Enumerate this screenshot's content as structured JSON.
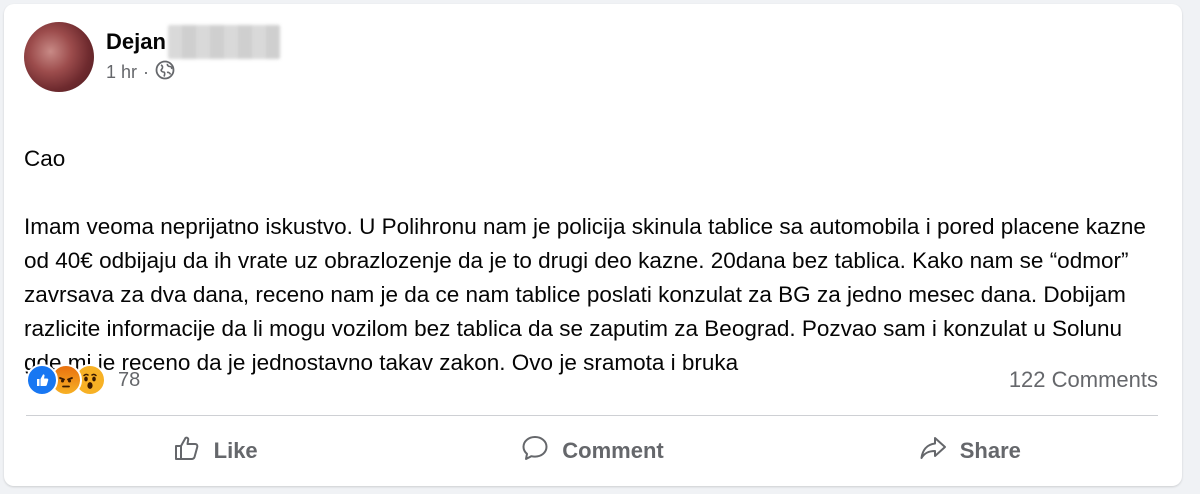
{
  "post": {
    "author": "Dejan",
    "time": "1 hr",
    "separator": "·",
    "privacy_icon": "globe-icon",
    "paragraphs": [
      "Cao",
      "Imam veoma neprijatno iskustvo. U Polihronu nam je policija skinula tablice sa automobila i pored placene kazne od 40€ odbijaju da ih vrate uz obrazlozenje da je to drugi deo kazne. 20dana bez tablica. Kako nam se “odmor” zavrsava za dva dana, receno nam je da ce nam tablice poslati konzulat za BG za jedno mesec dana. Dobijam razlicite informacije da li mogu vozilom bez tablica da se zaputim za Beograd. Pozvao sam i konzulat u Solunu gde mi je receno da je jednostavno takav zakon. Ovo je sramota i bruka"
    ]
  },
  "reactions": {
    "icons": [
      "like-reaction-icon",
      "angry-reaction-icon",
      "wow-reaction-icon"
    ],
    "count": "78"
  },
  "comments_count": "122 Comments",
  "actions": {
    "like": "Like",
    "comment": "Comment",
    "share": "Share"
  },
  "colors": {
    "like_blue": "#1877f2",
    "secondary_text": "#65676b",
    "angry_orange": "#e9710f",
    "wow_yellow": "#f7b125"
  }
}
